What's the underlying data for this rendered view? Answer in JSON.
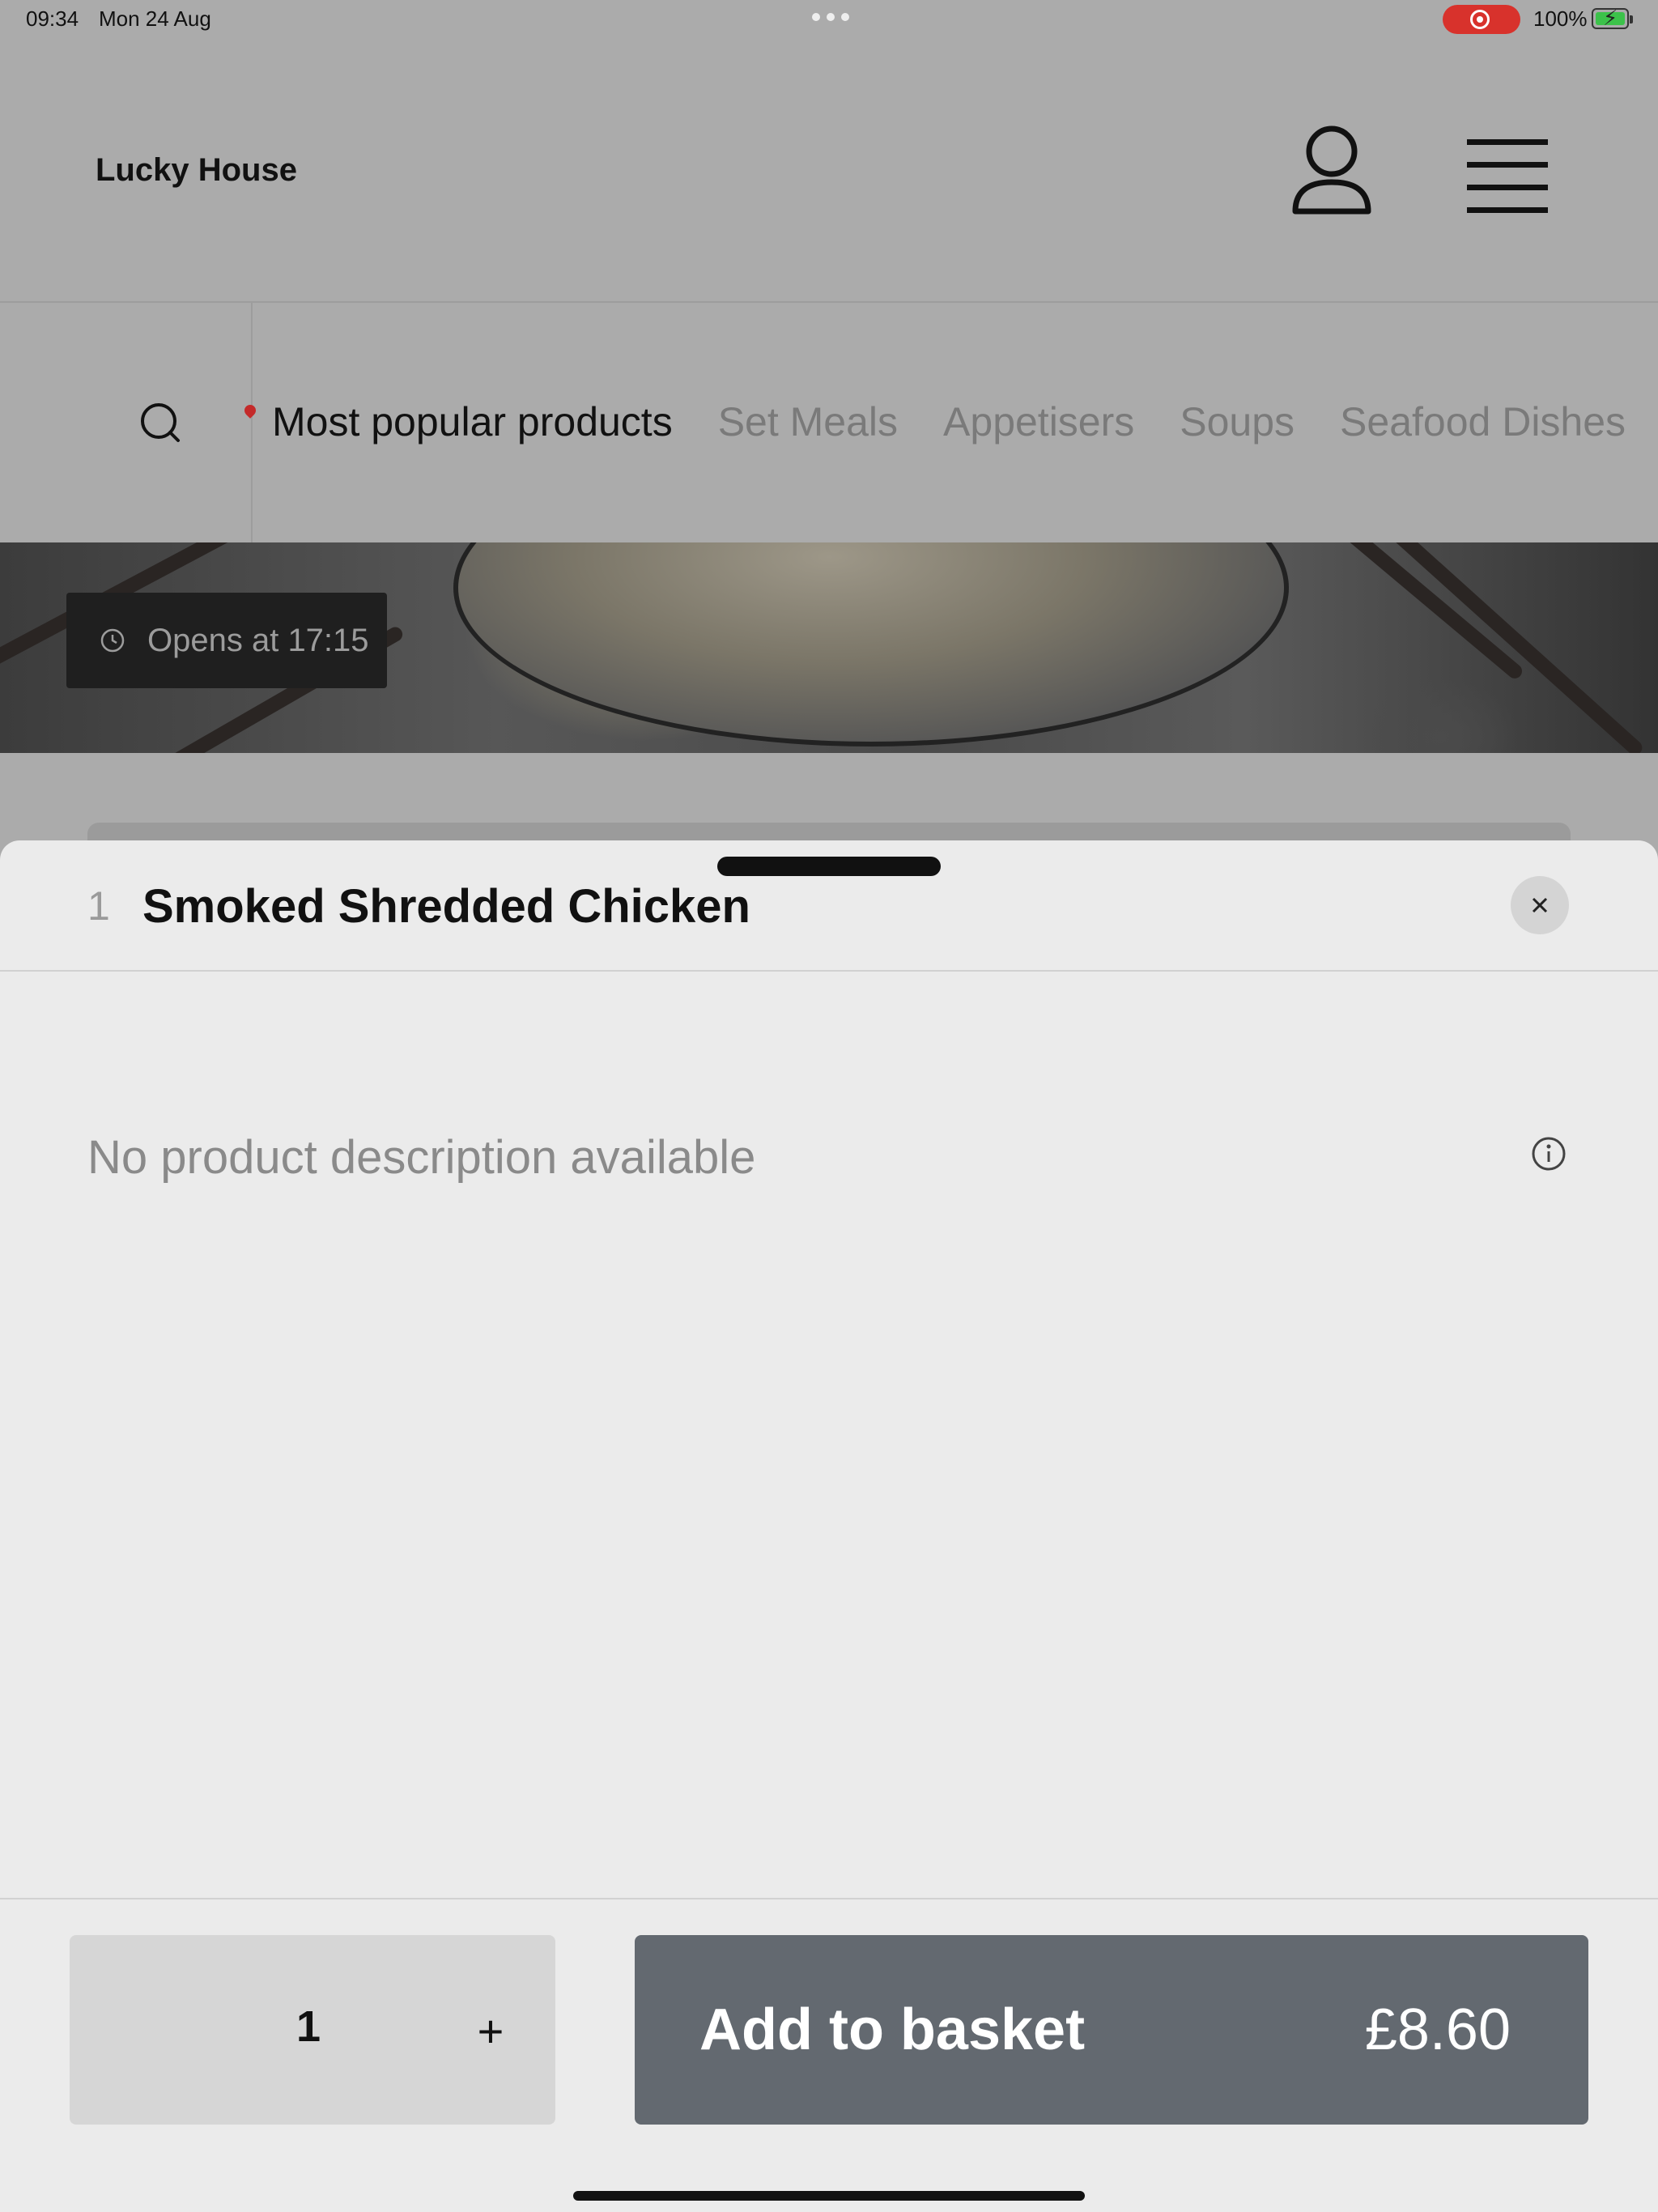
{
  "status_bar": {
    "time": "09:34",
    "date": "Mon 24 Aug",
    "battery_pct": "100%",
    "record_color": "#d8322c",
    "battery_color": "#3cc24a"
  },
  "header": {
    "brand": "Lucky House",
    "account_icon": "person-icon",
    "menu_icon": "hamburger-menu-icon"
  },
  "category_nav": {
    "search_icon": "search-icon",
    "tabs": [
      {
        "label": "Most popular products",
        "active": true
      },
      {
        "label": "Set Meals",
        "active": false
      },
      {
        "label": "Appetisers",
        "active": false
      },
      {
        "label": "Soups",
        "active": false
      },
      {
        "label": "Seafood Dishes",
        "active": false
      }
    ]
  },
  "hero": {
    "opens_text": "Opens at 17:15",
    "clock_icon": "clock-icon"
  },
  "sheet": {
    "item_qty": "1",
    "item_title": "Smoked Shredded Chicken",
    "close_icon": "close-icon",
    "description": "No product description available",
    "info_icon": "info-icon"
  },
  "footer": {
    "quantity": "1",
    "plus_label": "+",
    "add_label": "Add to basket",
    "price": "£8.60",
    "add_button_color": "#636970"
  }
}
